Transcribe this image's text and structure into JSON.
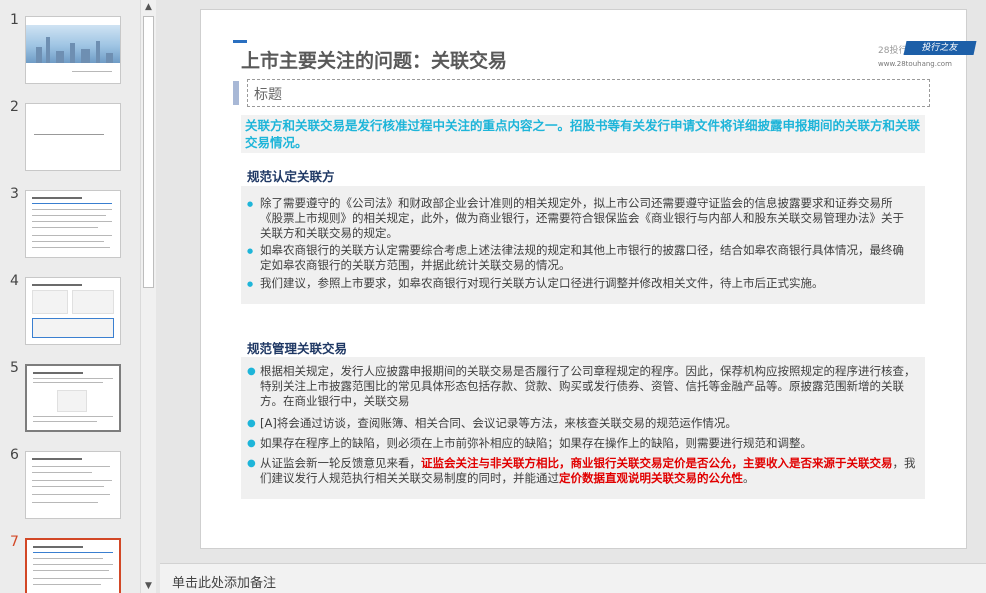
{
  "thumbnails": [
    {
      "num": "1"
    },
    {
      "num": "2"
    },
    {
      "num": "3"
    },
    {
      "num": "4"
    },
    {
      "num": "5"
    },
    {
      "num": "6"
    },
    {
      "num": "7"
    }
  ],
  "slide": {
    "title": "上市主要关注的问题：关联交易",
    "logo": {
      "left": "28投行",
      "badge": "投行之友",
      "url": "www.28touhang.com"
    },
    "placeholder": "标题",
    "lead": "关联方和关联交易是发行核准过程中关注的重点内容之一。招股书等有关发行申请文件将详细披露申报期间的关联方和关联交易情况。",
    "section1": {
      "heading": "规范认定关联方",
      "bullets": [
        "除了需要遵守的《公司法》和财政部企业会计准则的相关规定外，拟上市公司还需要遵守证监会的信息披露要求和证券交易所《股票上市规则》的相关规定，此外，做为商业银行，还需要符合银保监会《商业银行与内部人和股东关联交易管理办法》关于关联方和关联交易的规定。",
        "如皋农商银行的关联方认定需要综合考虑上述法律法规的规定和其他上市银行的披露口径，结合如皋农商银行具体情况，最终确定如皋农商银行的关联方范围，并据此统计关联交易的情况。",
        "我们建议，参照上市要求，如皋农商银行对现行关联方认定口径进行调整并修改相关文件，待上市后正式实施。"
      ]
    },
    "section2": {
      "heading": "规范管理关联交易",
      "bullets": [
        "根据相关规定，发行人应披露申报期间的关联交易是否履行了公司章程规定的程序。因此，保荐机构应按照规定的程序进行核查，特别关注上市披露范围比的常见具体形态包括存款、贷款、购买或发行债券、资管、信托等金融产品等。原披露范围新增的关联方。在商业银行中，关联交易",
        "[A]将会通过访谈，查阅账簿、相关合同、会议记录等方法，来核查关联交易的规范运作情况。",
        "如果存在程序上的缺陷，则必须在上市前弥补相应的缺陷；如果存在操作上的缺陷，则需要进行规范和调整。"
      ],
      "last_bullet": {
        "part1": "从证监会新一轮反馈意见来看，",
        "red1": "证监会关注与非关联方相比，商业银行关联交易定价是否公允，主要收入是否来源于关联交易",
        "part2": "，我们建议发行人规范执行相关关联交易制度的同时，并能通过",
        "red2": "定价数据直观说明关联交易的公允性",
        "part3": "。"
      }
    }
  },
  "notes_placeholder": "单击此处添加备注",
  "scrollbar": {
    "up": "▲",
    "down": "▼"
  }
}
